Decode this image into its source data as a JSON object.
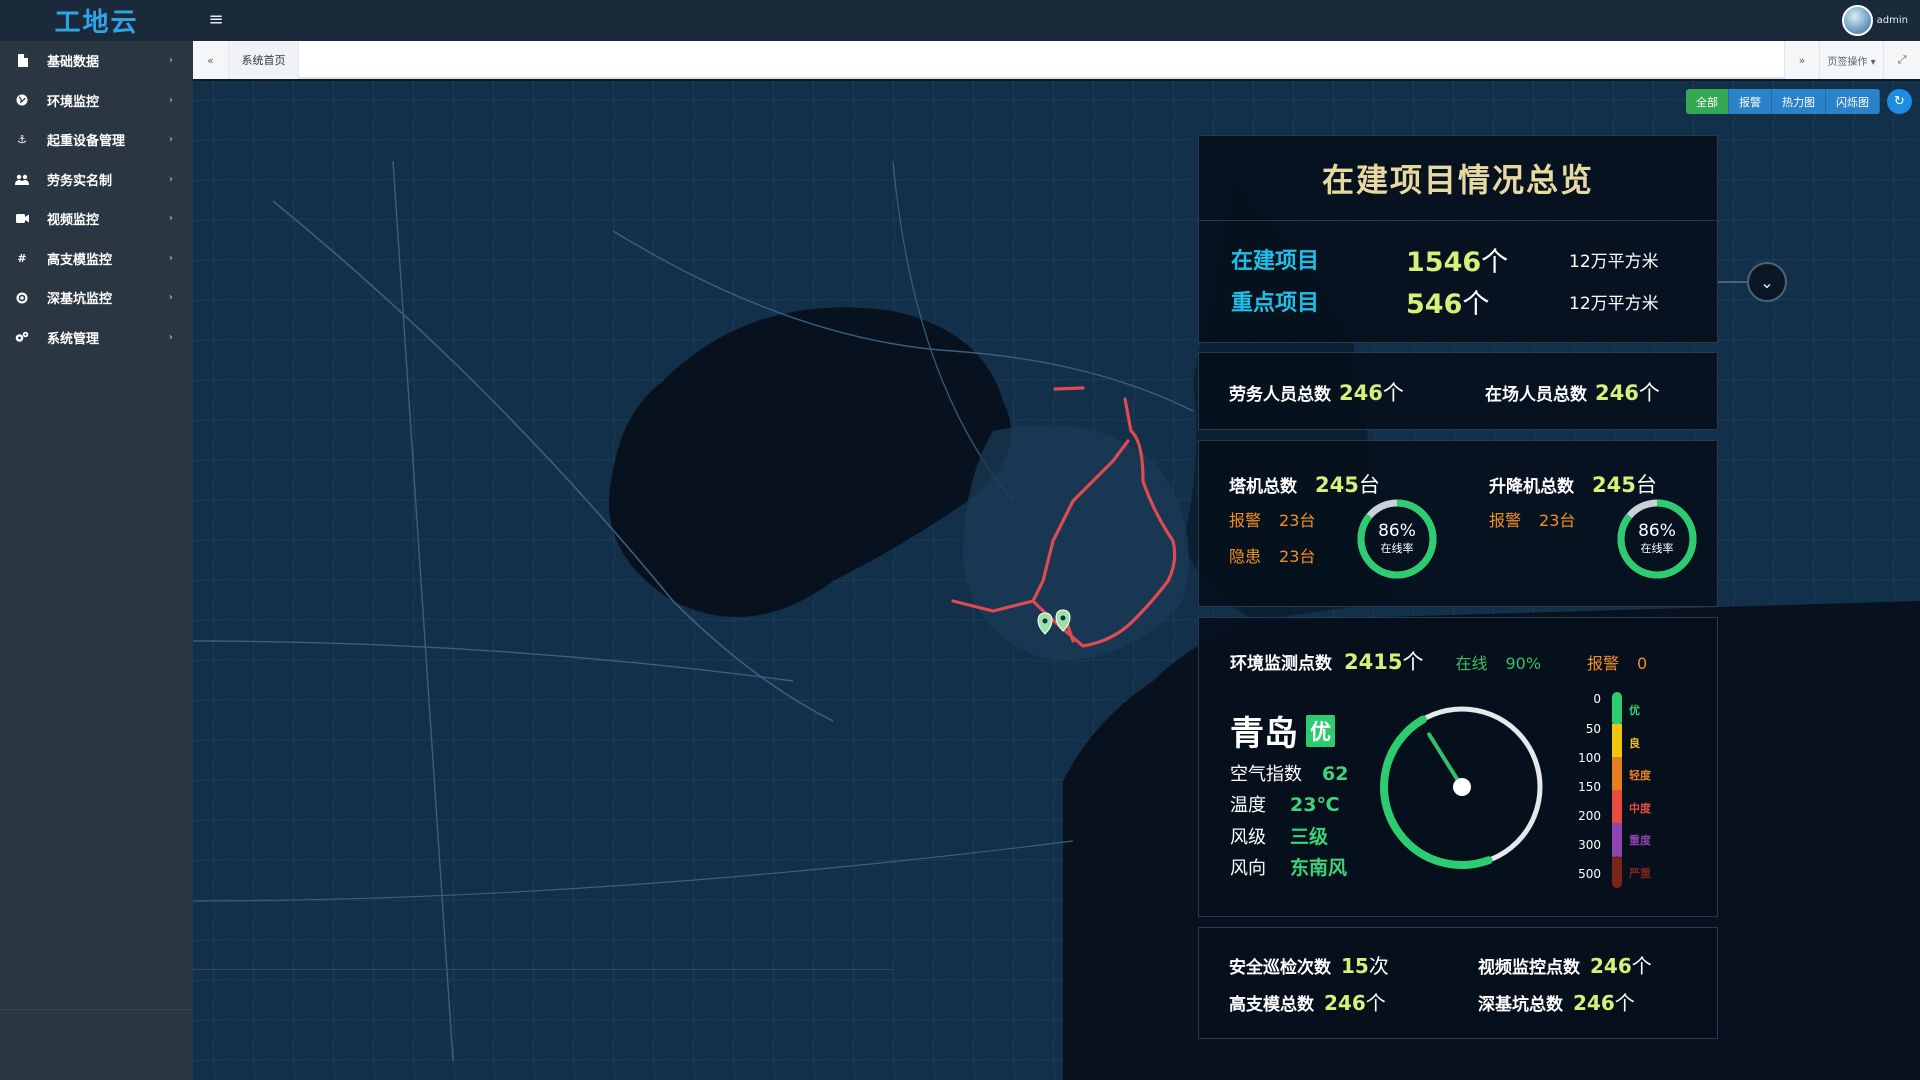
{
  "app": {
    "logo": "工地云",
    "user_name": "admin"
  },
  "sidebar": {
    "items": [
      {
        "label": "基础数据",
        "icon": "file-icon"
      },
      {
        "label": "环境监控",
        "icon": "globe-icon"
      },
      {
        "label": "起重设备管理",
        "icon": "anchor-icon"
      },
      {
        "label": "劳务实名制",
        "icon": "users-icon"
      },
      {
        "label": "视频监控",
        "icon": "video-icon"
      },
      {
        "label": "高支模监控",
        "icon": "hash-icon"
      },
      {
        "label": "深基坑监控",
        "icon": "target-icon"
      },
      {
        "label": "系统管理",
        "icon": "cogs-icon"
      }
    ]
  },
  "tabs": {
    "home": "系统首页",
    "ops": "页签操作 ▾"
  },
  "map_modes": [
    "全部",
    "报警",
    "热力图",
    "闪烁图"
  ],
  "overview": {
    "title": "在建项目情况总览",
    "projects": {
      "label": "在建项目",
      "value": "1546",
      "unit": "个",
      "area": "12万平方米"
    },
    "key_projects": {
      "label": "重点项目",
      "value": "546",
      "unit": "个",
      "area": "12万平方米"
    }
  },
  "labor": {
    "total_label": "劳务人员总数",
    "total_value": "246",
    "total_unit": "个",
    "onsite_label": "在场人员总数",
    "onsite_value": "246",
    "onsite_unit": "个"
  },
  "machines": {
    "tower": {
      "label": "塔机总数",
      "value": "245",
      "unit": "台",
      "alarm_label": "报警",
      "alarm_value": "23台",
      "hazard_label": "隐患",
      "hazard_value": "23台",
      "online_pct": "86%",
      "online_fraction": 0.86,
      "online_label": "在线率"
    },
    "lift": {
      "label": "升降机总数",
      "value": "245",
      "unit": "台",
      "alarm_label": "报警",
      "alarm_value": "23台",
      "online_pct": "86%",
      "online_fraction": 0.86,
      "online_label": "在线率"
    }
  },
  "environment": {
    "title": "环境监测点数",
    "count": "2415",
    "count_unit": "个",
    "online_label": "在线",
    "online_value": "90%",
    "alarm_label": "报警",
    "alarm_value": "0",
    "city": "青岛",
    "aq_level": "优",
    "air_index_label": "空气指数",
    "air_index_value": "62",
    "temp_label": "温度",
    "temp_value": "23℃",
    "wind_level_label": "风级",
    "wind_level_value": "三级",
    "wind_dir_label": "风向",
    "wind_dir_value": "东南风",
    "scale": [
      {
        "value": "0",
        "label": "优",
        "color": "#2ecc71"
      },
      {
        "value": "50",
        "label": "良",
        "color": "#f1c40f"
      },
      {
        "value": "100",
        "label": "轻度",
        "color": "#e67e22"
      },
      {
        "value": "150",
        "label": "中度",
        "color": "#e74c3c"
      },
      {
        "value": "200",
        "label": "重度",
        "color": "#8e44ad"
      },
      {
        "value": "300",
        "label": "严重",
        "color": "#7b241c"
      },
      {
        "value": "500",
        "label": "",
        "color": ""
      }
    ]
  },
  "misc": {
    "patrol_label": "安全巡检次数",
    "patrol_value": "15",
    "patrol_unit": "次",
    "video_label": "视频监控点数",
    "video_value": "246",
    "video_unit": "个",
    "formwork_label": "高支模总数",
    "formwork_value": "246",
    "formwork_unit": "个",
    "pit_label": "深基坑总数",
    "pit_value": "246",
    "pit_unit": "个"
  }
}
